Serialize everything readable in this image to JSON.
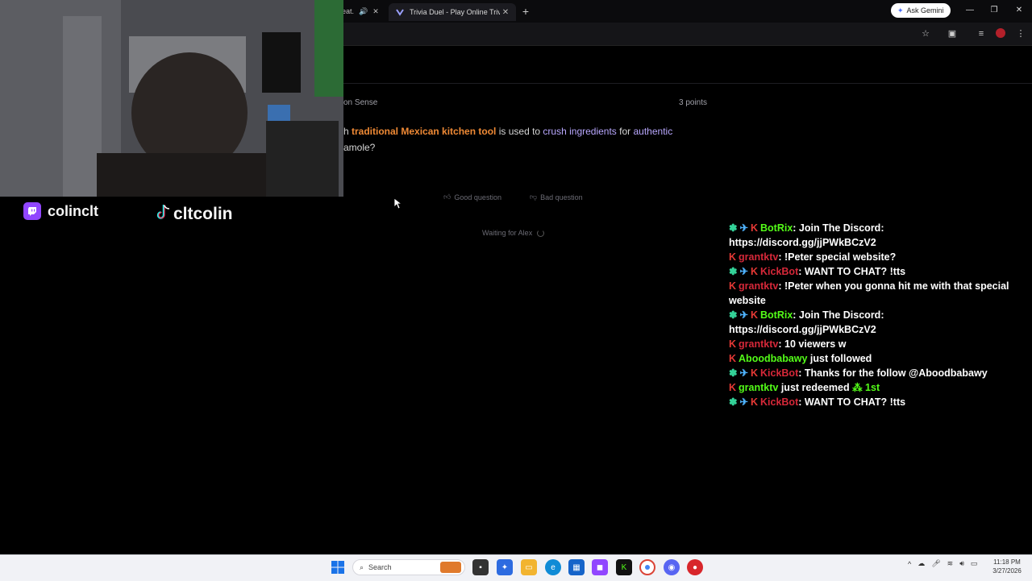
{
  "browser": {
    "prev_tab_label": "eat.",
    "active_tab_title": "Trivia Duel - Play Online Trivia",
    "ask_gemini_label": "Ask Gemini"
  },
  "quiz": {
    "category": "on Sense",
    "points": "3 points",
    "question_parts": {
      "p1": "h ",
      "h1": "traditional Mexican kitchen tool",
      "p2": " is used to ",
      "k1": "crush ingredients",
      "p3": " for ",
      "k2": "authentic",
      "p4": "amole?"
    },
    "good_question_label": "Good question",
    "bad_question_label": "Bad question",
    "waiting_text": "Waiting for Alex"
  },
  "overlay": {
    "twitch_handle": "colinclt",
    "tiktok_handle": "cltcolin"
  },
  "chat": [
    {
      "user": "BotRix",
      "user_color": "green",
      "badges": [
        "g",
        "b",
        "k"
      ],
      "text": ": Join The Discord:"
    },
    {
      "user": "",
      "user_color": "",
      "badges": [],
      "text": "https://discord.gg/jjPWkBCzV2"
    },
    {
      "user": "grantktv",
      "user_color": "red",
      "badges": [
        "k"
      ],
      "text": ": !Peter special website?"
    },
    {
      "user": "KickBot",
      "user_color": "red",
      "badges": [
        "g",
        "b",
        "k"
      ],
      "text": ": WANT TO CHAT? !tts"
    },
    {
      "user": "grantktv",
      "user_color": "red",
      "badges": [
        "k"
      ],
      "text": ": !Peter when you gonna hit me with that special website"
    },
    {
      "user": "BotRix",
      "user_color": "green",
      "badges": [
        "g",
        "b",
        "k"
      ],
      "text": ": Join The Discord:"
    },
    {
      "user": "",
      "user_color": "",
      "badges": [],
      "text": "https://discord.gg/jjPWkBCzV2"
    },
    {
      "user": "grantktv",
      "user_color": "red",
      "badges": [
        "k"
      ],
      "text": ": 10 viewers w"
    },
    {
      "user": "Aboodbabawy",
      "user_color": "green",
      "badges": [
        "k"
      ],
      "text": " just followed"
    },
    {
      "user": "KickBot",
      "user_color": "red",
      "badges": [
        "g",
        "b",
        "k"
      ],
      "text": ": Thanks for the follow @Aboodbabawy"
    },
    {
      "user": "grantktv",
      "user_color": "green",
      "badges": [
        "k"
      ],
      "text": " just redeemed ",
      "extra": "1st"
    },
    {
      "user": "KickBot",
      "user_color": "red",
      "badges": [
        "g",
        "b",
        "k"
      ],
      "text": ": WANT TO CHAT? !tts"
    }
  ],
  "taskbar": {
    "search_placeholder": "Search",
    "time": "11:18 PM",
    "date": "3/27/2026"
  }
}
